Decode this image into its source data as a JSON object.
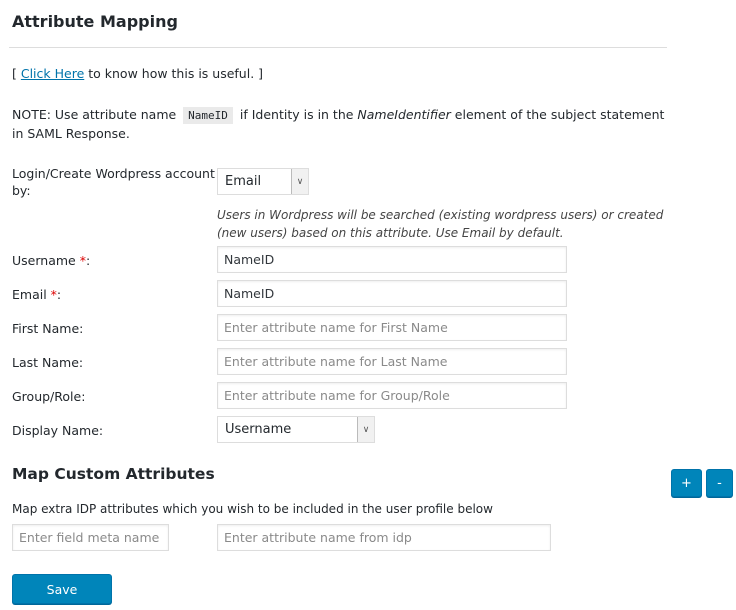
{
  "header": {
    "title": "Attribute Mapping"
  },
  "help": {
    "prefix": "[ ",
    "link_label": "Click Here",
    "suffix": " to know how this is useful. ]"
  },
  "note": {
    "label": "NOTE:",
    "text1": " Use attribute name ",
    "code": "NameID",
    "text2": " if Identity is in the ",
    "italic": "NameIdentifier",
    "text3": " element of the subject statement in SAML Response."
  },
  "login_by": {
    "label": "Login/Create Wordpress account by:",
    "selected": "Email",
    "hint": "Users in Wordpress will be searched (existing wordpress users) or created (new users) based on this attribute. Use Email by default."
  },
  "fields": [
    {
      "label": "Username",
      "required": true,
      "value": "NameID",
      "placeholder": ""
    },
    {
      "label": "Email",
      "required": true,
      "value": "NameID",
      "placeholder": ""
    },
    {
      "label": "First Name:",
      "required": false,
      "value": "",
      "placeholder": "Enter attribute name for First Name"
    },
    {
      "label": "Last Name:",
      "required": false,
      "value": "",
      "placeholder": "Enter attribute name for Last Name"
    },
    {
      "label": "Group/Role:",
      "required": false,
      "value": "",
      "placeholder": "Enter attribute name for Group/Role"
    }
  ],
  "required_marker": "*",
  "colon": ":",
  "display_name": {
    "label": "Display Name:",
    "selected": "Username"
  },
  "custom": {
    "title": "Map Custom Attributes",
    "add_label": "+",
    "remove_label": "-",
    "description": "Map extra IDP attributes which you wish to be included in the user profile below",
    "meta_placeholder": "Enter field meta name",
    "idp_placeholder": "Enter attribute name from idp"
  },
  "save_label": "Save",
  "colors": {
    "primary": "#0085ba",
    "link": "#0073aa",
    "required": "#dd0000"
  }
}
